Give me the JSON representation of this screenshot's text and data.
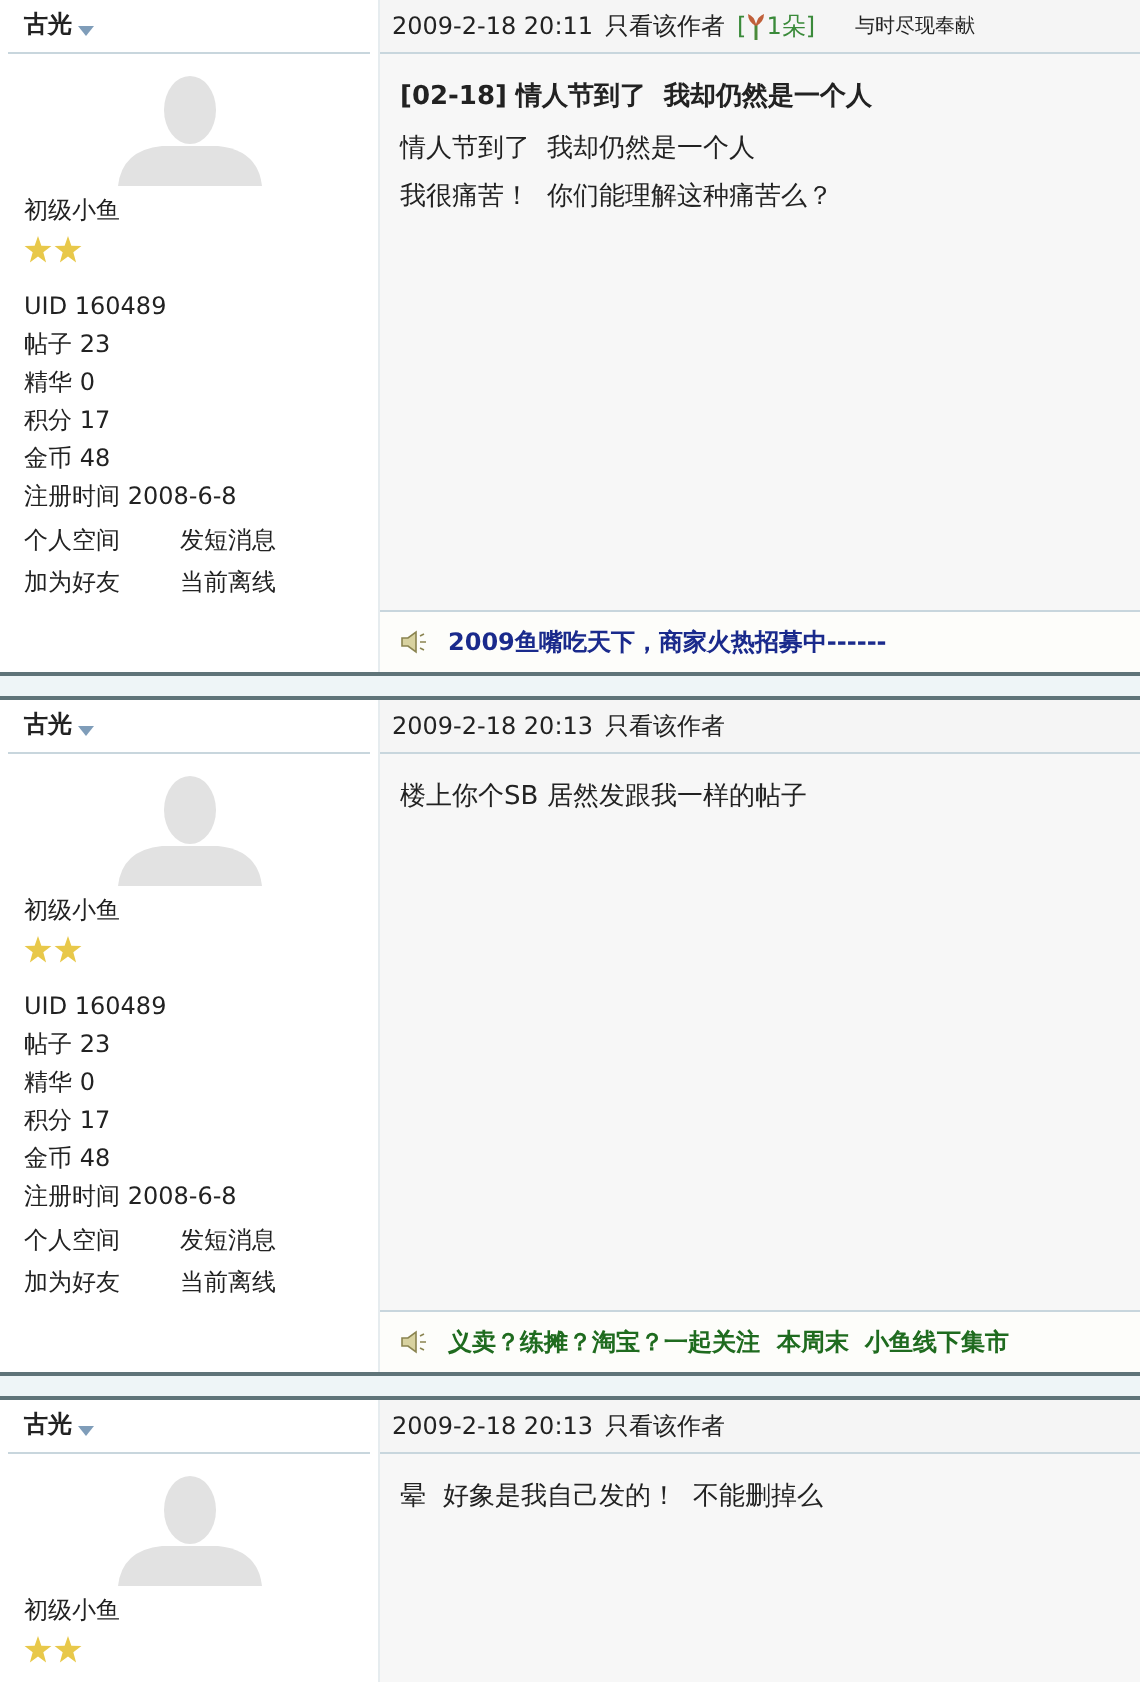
{
  "posts": [
    {
      "author": "古光",
      "rank": "初级小鱼",
      "rank_icons": [
        {
          "kind": "star"
        },
        {
          "kind": "star"
        }
      ],
      "profile": [
        {
          "label": "UID",
          "value": "160489"
        },
        {
          "label": "帖子",
          "value": "23"
        },
        {
          "label": "精华",
          "value": "0"
        },
        {
          "label": "积分",
          "value": "17"
        },
        {
          "label": "金币",
          "value": "48"
        },
        {
          "label": "注册时间",
          "value": "2008-6-8"
        }
      ],
      "links": [
        "个人空间",
        "发短消息",
        "加为好友",
        "当前离线"
      ],
      "date": "2009-2-18 20:11",
      "view_author": "只看该作者",
      "flower_open": "[",
      "flower": "1朵",
      "flower_close": "]",
      "note": "与时尽现奉献",
      "title": "[02-18] 情人节到了  我却仍然是一个人",
      "body": [
        "情人节到了  我却仍然是一个人",
        "我很痛苦！  你们能理解这种痛苦么？"
      ],
      "ad": {
        "text": "2009鱼嘴吃天下，商家火热招募中------",
        "color": "#1a2a8c"
      }
    },
    {
      "author": "古光",
      "rank": "初级小鱼",
      "rank_icons": [
        {
          "kind": "star"
        },
        {
          "kind": "star"
        }
      ],
      "profile": [
        {
          "label": "UID",
          "value": "160489"
        },
        {
          "label": "帖子",
          "value": "23"
        },
        {
          "label": "精华",
          "value": "0"
        },
        {
          "label": "积分",
          "value": "17"
        },
        {
          "label": "金币",
          "value": "48"
        },
        {
          "label": "注册时间",
          "value": "2008-6-8"
        }
      ],
      "links": [
        "个人空间",
        "发短消息",
        "加为好友",
        "当前离线"
      ],
      "date": "2009-2-18 20:13",
      "view_author": "只看该作者",
      "body": [
        "楼上你个SB 居然发跟我一样的帖子"
      ],
      "ad": {
        "text": "义卖？练摊？淘宝？一起关注  本周末  小鱼线下集市",
        "color": "#1f6b1f"
      }
    },
    {
      "author": "古光",
      "rank": "初级小鱼",
      "rank_icons": [
        {
          "kind": "star"
        },
        {
          "kind": "star"
        }
      ],
      "date": "2009-2-18 20:13",
      "view_author": "只看该作者",
      "body": [
        "晕  好象是我自己发的！  不能删掉么"
      ]
    }
  ]
}
